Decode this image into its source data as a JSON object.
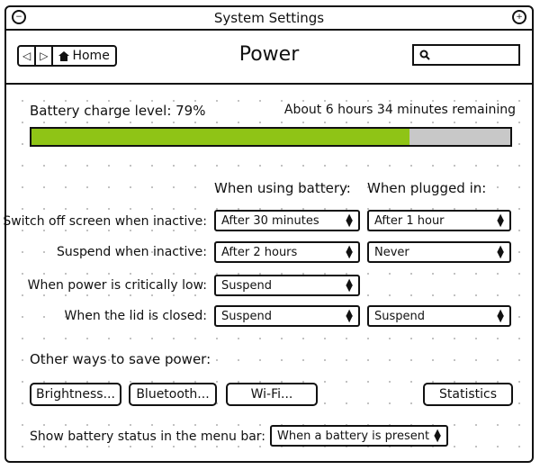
{
  "window": {
    "title": "System Settings"
  },
  "toolbar": {
    "back_glyph": "◁",
    "forward_glyph": "▷",
    "home_label": "Home",
    "home_icon": "home-icon",
    "search_value": ""
  },
  "page": {
    "title": "Power"
  },
  "battery": {
    "label": "Battery charge level: 79%",
    "remaining": "About 6 hours 34 minutes remaining",
    "level_percent": 79
  },
  "columns": {
    "battery": "When using battery:",
    "plugged": "When plugged in:"
  },
  "rows": [
    {
      "label": "Switch off screen when inactive:",
      "battery": "After 30 minutes",
      "plugged": "After 1 hour"
    },
    {
      "label": "Suspend when inactive:",
      "battery": "After 2 hours",
      "plugged": "Never"
    },
    {
      "label": "When power is critically low:",
      "battery": "Suspend"
    },
    {
      "label": "When the lid is closed:",
      "battery": "Suspend",
      "plugged": "Suspend"
    }
  ],
  "other": {
    "label": "Other ways to save power:",
    "buttons": [
      "Brightness...",
      "Bluetooth...",
      "Wi-Fi..."
    ],
    "statistics": "Statistics"
  },
  "menubar": {
    "label": "Show battery status in the menu bar:",
    "value": "When a battery is present"
  },
  "colors": {
    "battery_fill": "#8fc416",
    "battery_empty": "#c8c8c8"
  }
}
